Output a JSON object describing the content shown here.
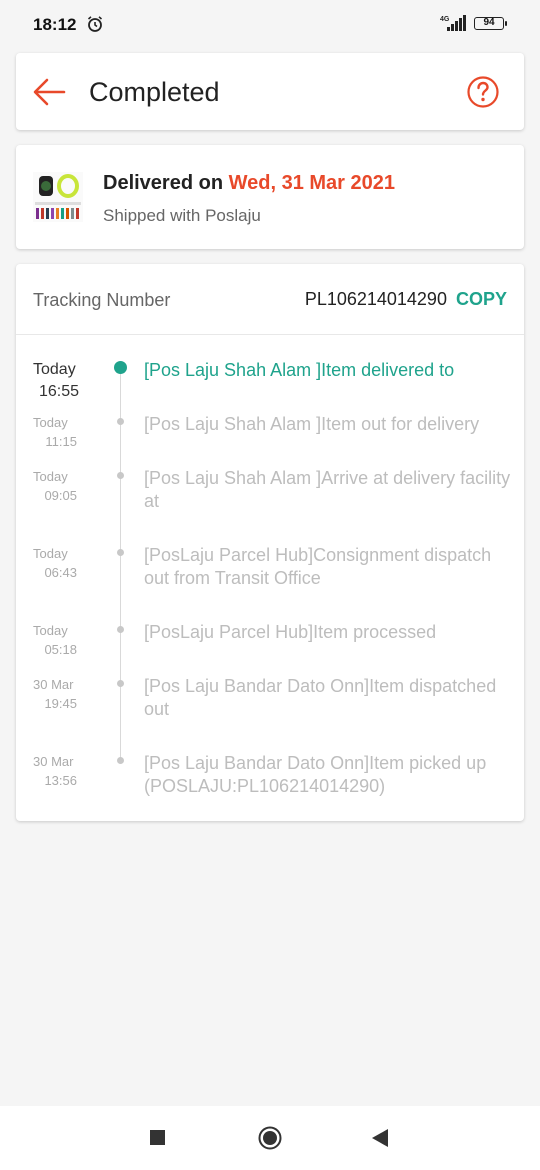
{
  "status_bar": {
    "time": "18:12",
    "network_label": "4G",
    "battery": "94",
    "icons": [
      "alarm-icon",
      "signal-icon",
      "battery-icon"
    ]
  },
  "header": {
    "title": "Completed",
    "back_icon": "arrow-left-icon",
    "help_icon": "question-circle-icon",
    "accent_color": "#e8492a"
  },
  "delivery": {
    "delivered_prefix": "Delivered on",
    "delivered_date": "Wed, 31 Mar 2021",
    "shipped_text": "Shipped with Poslaju"
  },
  "tracking": {
    "label": "Tracking Number",
    "number": "PL106214014290",
    "copy_label": "COPY",
    "copy_color": "#1fa38c",
    "events": [
      {
        "day": "Today",
        "time": "16:55",
        "text": "[Pos Laju Shah Alam ]Item delivered to"
      },
      {
        "day": "Today",
        "time": "11:15",
        "text": "[Pos Laju Shah Alam ]Item out for delivery"
      },
      {
        "day": "Today",
        "time": "09:05",
        "text": "[Pos Laju Shah Alam ]Arrive at delivery facility at"
      },
      {
        "day": "Today",
        "time": "06:43",
        "text": "[PosLaju Parcel Hub]Consignment dispatch out from Transit Office"
      },
      {
        "day": "Today",
        "time": "05:18",
        "text": "[PosLaju Parcel Hub]Item processed"
      },
      {
        "day": "30 Mar",
        "time": "19:45",
        "text": "[Pos Laju Bandar Dato Onn]Item dispatched out"
      },
      {
        "day": "30 Mar",
        "time": "13:56",
        "text": "[Pos Laju Bandar Dato Onn]Item picked up (POSLAJU:PL106214014290)"
      }
    ]
  },
  "nav_bar": {
    "icons": [
      "recents-square-icon",
      "home-circle-icon",
      "back-triangle-icon"
    ]
  }
}
